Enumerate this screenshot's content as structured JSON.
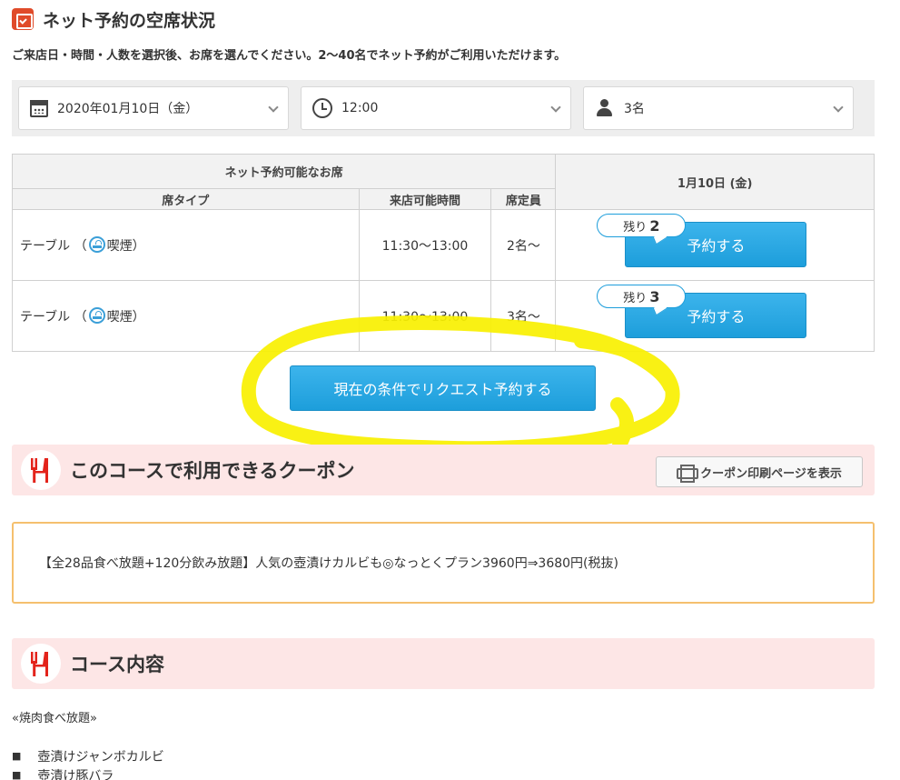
{
  "page": {
    "title": "ネット予約の空席状況",
    "subtitle": "ご来店日・時間・人数を選択後、お席を選んでください。2〜40名でネット予約がご利用いただけます。"
  },
  "filters": {
    "date": "2020年01月10日（金）",
    "time": "12:00",
    "party": "3名"
  },
  "table": {
    "group_header": "ネット予約可能なお席",
    "col_seat_type": "席タイプ",
    "col_time": "来店可能時間",
    "col_capacity": "席定員",
    "date_header": "1月10日 (金)",
    "rows": [
      {
        "seat_prefix": "テーブル （",
        "smoking": "喫煙）",
        "time": "11:30〜13:00",
        "capacity": "2名〜",
        "remain_label": "残り",
        "remain_count": "2",
        "button": "予約する"
      },
      {
        "seat_prefix": "テーブル （",
        "smoking": "喫煙）",
        "time": "11:30〜13:00",
        "capacity": "3名〜",
        "remain_label": "残り",
        "remain_count": "3",
        "button": "予約する"
      }
    ]
  },
  "request_button": "現在の条件でリクエスト予約する",
  "coupon_section": {
    "title": "このコースで利用できるクーポン",
    "print_button": "クーポン印刷ページを表示"
  },
  "coupon_text": "【全28品食べ放題+120分飲み放題】人気の壺漬けカルビも◎なっとくプラン3960円⇒3680円(税抜)",
  "course_section": {
    "title": "コース内容"
  },
  "course": {
    "intro": "«焼肉食べ放題»",
    "items": [
      "壺漬けジャンボカルビ",
      "壺漬け豚バラ"
    ]
  },
  "colors": {
    "accent_blue": "#1d9edb",
    "section_pink": "#fde6e6",
    "highlight_yellow": "#f8f000",
    "coupon_border": "#f5c06e",
    "brand_red": "#e04b2a"
  },
  "icons": {
    "title": "calendar-check-icon",
    "date": "calendar-icon",
    "time": "clock-icon",
    "party": "person-icon",
    "smoking": "smoking-icon",
    "section": "fork-knife-icon",
    "print": "printer-icon"
  }
}
